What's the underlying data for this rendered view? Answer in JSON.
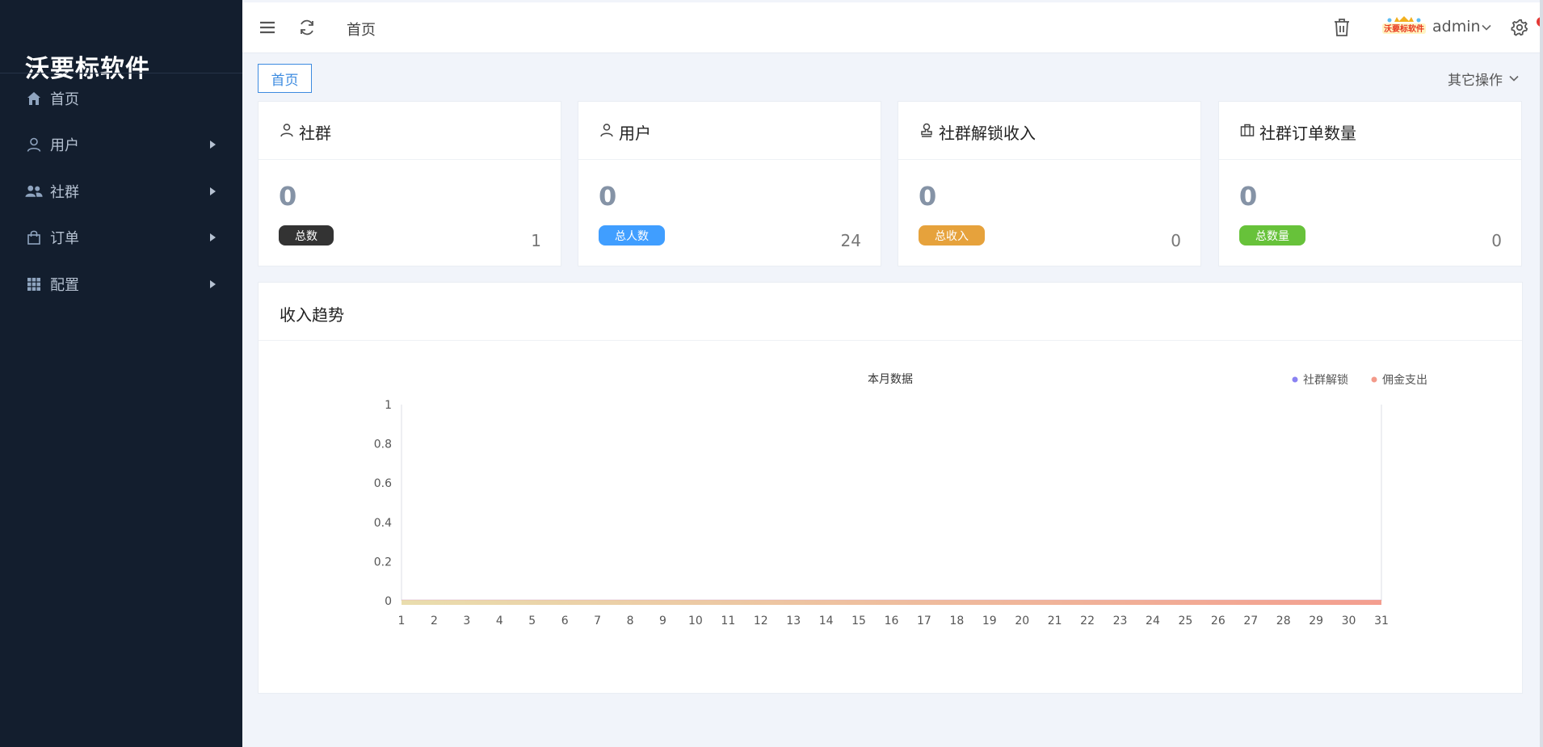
{
  "sidebar": {
    "brand": "沃要标软件",
    "items": [
      {
        "label": "首页",
        "icon": "home-icon",
        "has_children": false
      },
      {
        "label": "用户",
        "icon": "user-icon",
        "has_children": true
      },
      {
        "label": "社群",
        "icon": "users-icon",
        "has_children": true
      },
      {
        "label": "订单",
        "icon": "shopping-bag-icon",
        "has_children": true
      },
      {
        "label": "配置",
        "icon": "grid-icon",
        "has_children": true
      }
    ]
  },
  "header": {
    "title": "首页",
    "user_name": "admin",
    "logo_text": "沃要标软件",
    "icons": [
      "menu-icon",
      "refresh-icon",
      "trash-icon",
      "settings-icon"
    ]
  },
  "tabs": {
    "active": "首页",
    "other_ops": "其它操作"
  },
  "cards": [
    {
      "title": "社群",
      "icon": "user-icon",
      "value": "0",
      "badge": "总数",
      "badge_color": "#333333",
      "count": "1"
    },
    {
      "title": "用户",
      "icon": "user-icon",
      "value": "0",
      "badge": "总人数",
      "badge_color": "#409eff",
      "count": "24"
    },
    {
      "title": "社群解锁收入",
      "icon": "stamp-icon",
      "value": "0",
      "badge": "总收入",
      "badge_color": "#e6a23c",
      "count": "0"
    },
    {
      "title": "社群订单数量",
      "icon": "briefcase-icon",
      "value": "0",
      "badge": "总数量",
      "badge_color": "#67c23a",
      "count": "0"
    }
  ],
  "income_panel": {
    "title": "收入趋势"
  },
  "chart_data": {
    "type": "area",
    "title": "本月数据",
    "x": [
      1,
      2,
      3,
      4,
      5,
      6,
      7,
      8,
      9,
      10,
      11,
      12,
      13,
      14,
      15,
      16,
      17,
      18,
      19,
      20,
      21,
      22,
      23,
      24,
      25,
      26,
      27,
      28,
      29,
      30,
      31
    ],
    "series": [
      {
        "name": "社群解锁",
        "color": "#8a82f2",
        "values": [
          0,
          0,
          0,
          0,
          0,
          0,
          0,
          0,
          0,
          0,
          0,
          0,
          0,
          0,
          0,
          0,
          0,
          0,
          0,
          0,
          0,
          0,
          0,
          0,
          0,
          0,
          0,
          0,
          0,
          0,
          0
        ]
      },
      {
        "name": "佣金支出",
        "color": "#f39a8a",
        "values": [
          0,
          0,
          0,
          0,
          0,
          0,
          0,
          0,
          0,
          0,
          0,
          0,
          0,
          0,
          0,
          0,
          0,
          0,
          0,
          0,
          0,
          0,
          0,
          0,
          0,
          0,
          0,
          0,
          0,
          0,
          0
        ]
      }
    ],
    "yticks": [
      "0",
      "0.2",
      "0.4",
      "0.6",
      "0.8",
      "1"
    ],
    "ylim": [
      0,
      1
    ],
    "legend_position": "top-right",
    "grid": false
  }
}
